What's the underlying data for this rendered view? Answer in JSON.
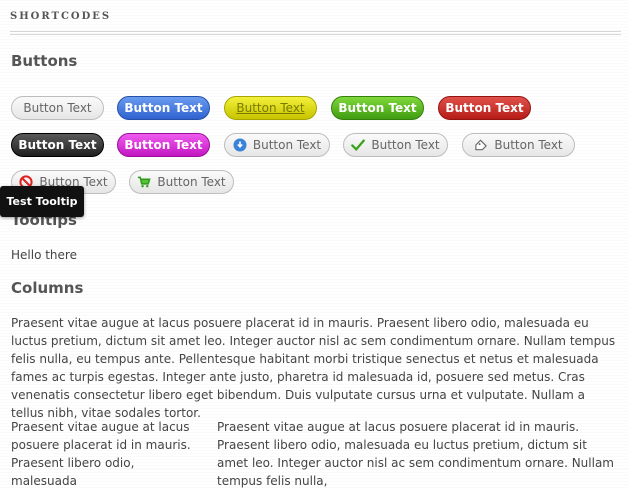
{
  "section_title": "SHORTCODES",
  "headings": {
    "buttons": "Buttons",
    "tooltips": "Tooltips",
    "columns": "Columns"
  },
  "buttons": {
    "row1": [
      "Button Text",
      "Button Text",
      "Button Text",
      "Button Text",
      "Button Text"
    ],
    "row2": [
      "Button Text",
      "Button Text",
      "Button Text",
      "Button Text",
      "Button Text"
    ],
    "row3": [
      "Button Text",
      "Button Text"
    ]
  },
  "tooltip": {
    "label": "Test Tooltip",
    "trigger_text": "Hello there"
  },
  "columns": {
    "full": "Praesent vitae augue at lacus posuere placerat id in mauris. Praesent libero odio, malesuada eu luctus pretium, dictum sit amet leo. Integer auctor nisl ac sem condimentum ornare. Nullam tempus felis nulla, eu tempus ante. Pellentesque habitant morbi tristique senectus et netus et malesuada fames ac turpis egestas. Integer ante justo, pharetra id malesuada id, posuere sed metus. Cras venenatis consectetur libero eget bibendum. Duis vulputate cursus urna et vulputate. Nullam a tellus nibh, vitae sodales tortor.",
    "left": "Praesent vitae augue at lacus posuere placerat id in mauris. Praesent libero odio, malesuada",
    "right": "Praesent vitae augue at lacus posuere placerat id in mauris. Praesent libero odio, malesuada eu luctus pretium, dictum sit amet leo. Integer auctor nisl ac sem condimentum ornare. Nullam tempus felis nulla,"
  },
  "icons": [
    "info-icon",
    "check-icon",
    "tag-icon",
    "no-entry-icon",
    "cart-icon"
  ]
}
